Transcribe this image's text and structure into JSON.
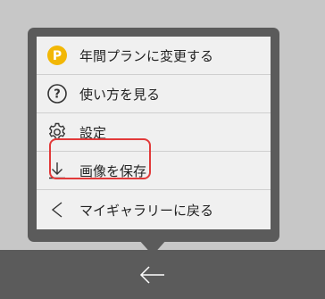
{
  "menu": {
    "items": [
      {
        "label": "年間プランに変更する",
        "icon": "premium-coin-icon",
        "badge": "P"
      },
      {
        "label": "使い方を見る",
        "icon": "help-circle-icon",
        "glyph": "?"
      },
      {
        "label": "設定",
        "icon": "gear-icon"
      },
      {
        "label": "画像を保存",
        "icon": "download-icon"
      },
      {
        "label": "マイギャラリーに戻る",
        "icon": "chevron-left-icon"
      }
    ]
  },
  "colors": {
    "background": "#c7c7c7",
    "popup": "#5b5b5b",
    "menu_bg": "#f0f0f0",
    "coin": "#f2b705",
    "highlight": "#e23a3a",
    "bottom_bar": "#5b5b5b"
  },
  "bottom_bar": {
    "back_icon": "back-arrow-icon"
  }
}
